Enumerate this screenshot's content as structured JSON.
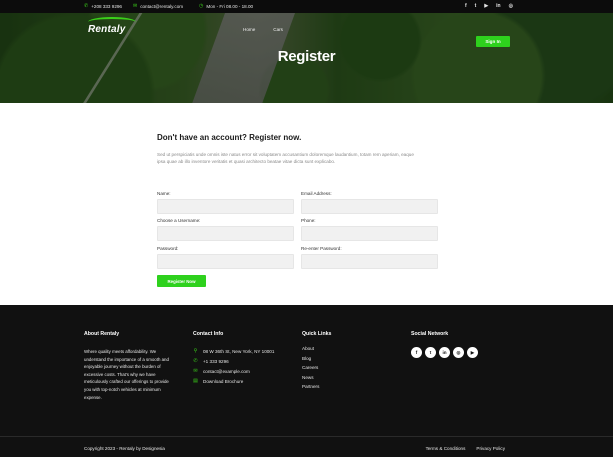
{
  "topbar": {
    "phone": "+208 333 9296",
    "email": "contact@rentaly.com",
    "hours": "Mon - Fri 08.00 - 18.00",
    "phone_icon": "phone-icon",
    "email_icon": "mail-icon",
    "clock_icon": "clock-icon",
    "socials": [
      "f",
      "t",
      "▶",
      "in",
      "◎"
    ]
  },
  "header": {
    "logo": "Rentaly",
    "nav": [
      "Home",
      "Cars"
    ],
    "signin_label": "Sign In"
  },
  "hero": {
    "title": "Register"
  },
  "form": {
    "heading": "Don't have an account? Register now.",
    "description": "Sed ut perspiciatis unde omnis iste natus error sit voluptatem accusantium doloremque laudantium, totam rem aperiam, eaque ipsa quae ab illo inventore veritatis et quasi architecto beatae vitae dicta sunt explicabo.",
    "fields": {
      "name": "Name:",
      "email": "Email Address:",
      "username": "Choose a Username:",
      "phone": "Phone:",
      "password": "Password:",
      "repassword": "Re-enter Password:"
    },
    "submit_label": "Register Now"
  },
  "footer": {
    "about": {
      "title": "About Rentaly",
      "text": "Where quality meets affordability. We understand the importance of a smooth and enjoyable journey without the burden of excessive costs. That's why we have meticulously crafted our offerings to provide you with top-notch vehicles at minimum expense."
    },
    "contact": {
      "title": "Contact Info",
      "items": [
        {
          "icon": "map-pin-icon",
          "text": "08 W 36th St, New York, NY 10001"
        },
        {
          "icon": "phone-icon",
          "text": "+1 333 9296"
        },
        {
          "icon": "mail-icon",
          "text": "contact@example.com"
        },
        {
          "icon": "file-icon",
          "text": "Download Brochure"
        }
      ]
    },
    "quick_links": {
      "title": "Quick Links",
      "items": [
        "About",
        "Blog",
        "Careers",
        "News",
        "Partners"
      ]
    },
    "social": {
      "title": "Social Network",
      "icons": [
        "f",
        "t",
        "in",
        "◎",
        "▶"
      ]
    },
    "copyright": "Copyright 2023 - Rentaly by Designesia",
    "terms": "Terms & Conditions",
    "privacy": "Privacy Policy"
  },
  "colors": {
    "accent": "#2ed11d",
    "dark": "#111111"
  }
}
